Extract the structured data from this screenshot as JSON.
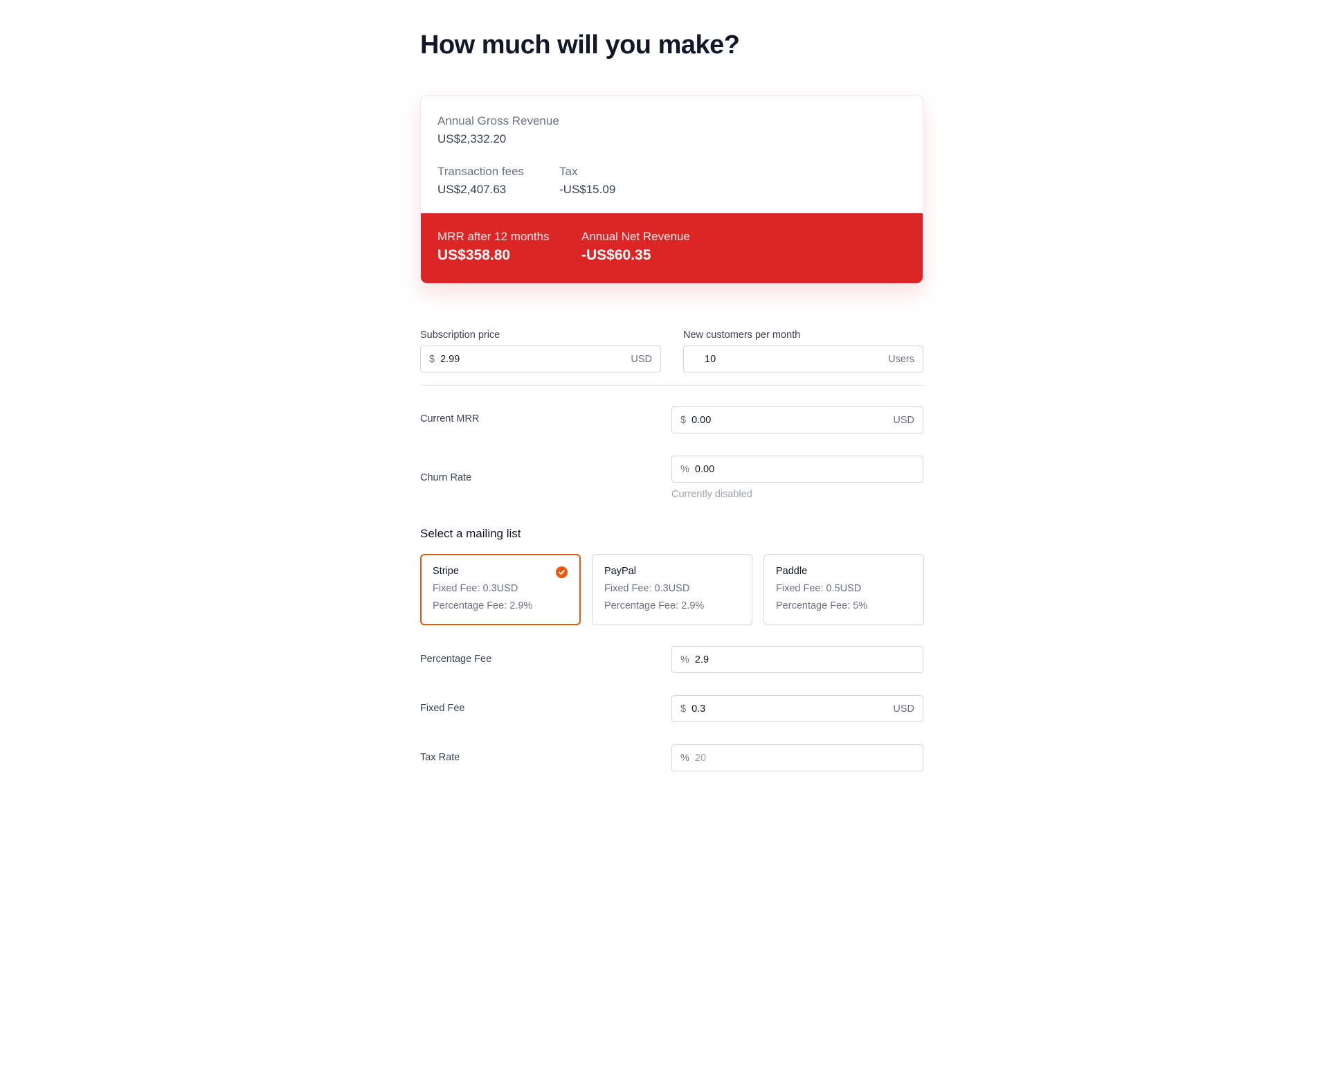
{
  "page": {
    "title": "How much will you make?"
  },
  "summary": {
    "annual_gross_revenue": {
      "label": "Annual Gross Revenue",
      "value": "US$2,332.20"
    },
    "transaction_fees": {
      "label": "Transaction fees",
      "value": "US$2,407.63"
    },
    "tax": {
      "label": "Tax",
      "value": "-US$15.09"
    },
    "mrr_after_12": {
      "label": "MRR after 12 months",
      "value": "US$358.80"
    },
    "annual_net_revenue": {
      "label": "Annual Net Revenue",
      "value": "-US$60.35"
    },
    "band_color": "#dc2626"
  },
  "form": {
    "subscription_price": {
      "label": "Subscription price",
      "prefix": "$",
      "value": "2.99",
      "suffix": "USD"
    },
    "new_customers": {
      "label": "New customers per month",
      "value": "10",
      "suffix": "Users"
    },
    "current_mrr": {
      "label": "Current MRR",
      "prefix": "$",
      "value": "0.00",
      "suffix": "USD"
    },
    "churn_rate": {
      "label": "Churn Rate",
      "prefix": "%",
      "value": "0.00",
      "hint": "Currently disabled"
    },
    "mailing_list": {
      "title": "Select a mailing list",
      "selected": "Stripe",
      "accent_color": "#ea580c",
      "options": [
        {
          "name": "Stripe",
          "fixed_fee": "Fixed Fee: 0.3USD",
          "percentage_fee": "Percentage Fee: 2.9%"
        },
        {
          "name": "PayPal",
          "fixed_fee": "Fixed Fee: 0.3USD",
          "percentage_fee": "Percentage Fee: 2.9%"
        },
        {
          "name": "Paddle",
          "fixed_fee": "Fixed Fee: 0.5USD",
          "percentage_fee": "Percentage Fee: 5%"
        }
      ]
    },
    "percentage_fee": {
      "label": "Percentage Fee",
      "prefix": "%",
      "value": "2.9"
    },
    "fixed_fee": {
      "label": "Fixed Fee",
      "prefix": "$",
      "value": "0.3",
      "suffix": "USD"
    },
    "tax_rate": {
      "label": "Tax Rate",
      "prefix": "%",
      "placeholder": "20"
    }
  }
}
